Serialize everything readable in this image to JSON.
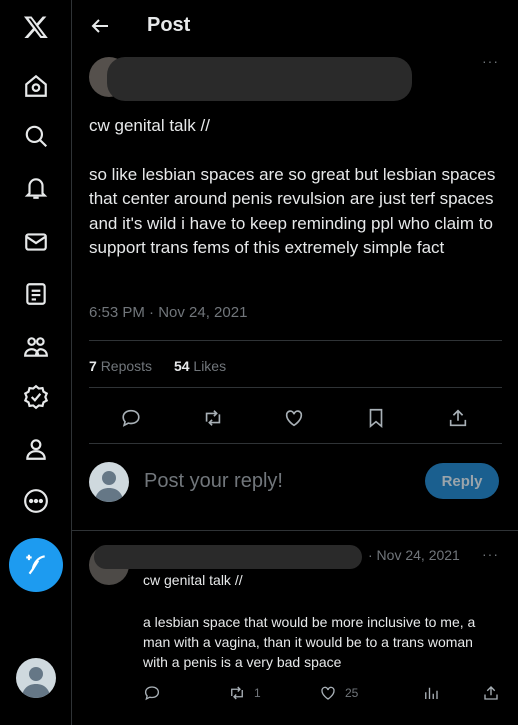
{
  "header": {
    "title": "Post"
  },
  "sidebar": {
    "items": [
      {
        "icon": "x-logo-icon"
      },
      {
        "icon": "home-icon"
      },
      {
        "icon": "search-icon"
      },
      {
        "icon": "notifications-icon"
      },
      {
        "icon": "messages-icon"
      },
      {
        "icon": "lists-icon"
      },
      {
        "icon": "communities-icon"
      },
      {
        "icon": "verified-icon"
      },
      {
        "icon": "profile-icon"
      },
      {
        "icon": "more-icon"
      },
      {
        "icon": "compose-icon"
      }
    ]
  },
  "post": {
    "content_warning": "cw genital talk //",
    "body": "so like lesbian spaces are so great but lesbian spaces that center around penis revulsion are just terf spaces and it's wild i have to keep reminding ppl who claim to support trans fems of this extremely simple fact",
    "timestamp": "6:53 PM · Nov 24, 2021",
    "reposts_count": "7",
    "reposts_label": "Reposts",
    "likes_count": "54",
    "likes_label": "Likes"
  },
  "composer": {
    "placeholder": "Post your reply!",
    "reply_button": "Reply"
  },
  "reply": {
    "timestamp": "· Nov 24, 2021",
    "content_warning": "cw genital talk //",
    "body": "a lesbian space that would be more inclusive to me, a man with a vagina, than it would be to a trans woman with a penis is a very bad space",
    "retweet_count": "1",
    "like_count": "25"
  },
  "more_glyph": "···",
  "colors": {
    "accent": "#1d9bf0",
    "text": "#e7e9ea",
    "muted": "#71767b",
    "border": "#2f3336"
  }
}
